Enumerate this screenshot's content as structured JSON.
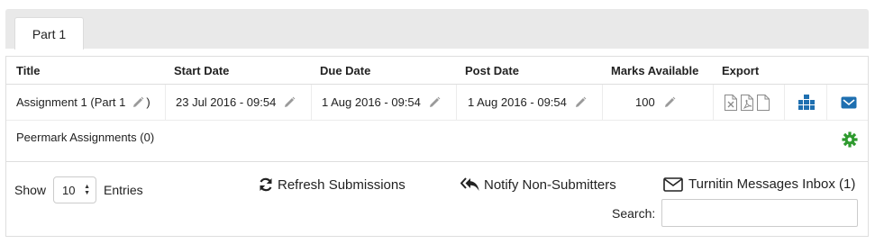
{
  "tabs": [
    {
      "label": "Part 1"
    }
  ],
  "table": {
    "headers": {
      "title": "Title",
      "start_date": "Start Date",
      "due_date": "Due Date",
      "post_date": "Post Date",
      "marks": "Marks Available",
      "export": "Export"
    },
    "row": {
      "title": "Assignment 1 (Part 1",
      "title_suffix": ")",
      "start_date": "23 Jul 2016 - 09:54",
      "due_date": "1 Aug 2016 - 09:54",
      "post_date": "1 Aug 2016 - 09:54",
      "marks": "100"
    }
  },
  "peermark": {
    "label": "Peermark Assignments (0)"
  },
  "controls": {
    "show_label": "Show",
    "entries_value": "10",
    "entries_label": "Entries",
    "refresh_label": "Refresh Submissions",
    "notify_label": "Notify Non-Submitters",
    "messages_label": "Turnitin Messages Inbox (1)",
    "search_label": "Search:",
    "search_value": ""
  },
  "icons": {
    "edit": "pencil-icon",
    "export_xls": "xls-file-icon",
    "export_pdf": "pdf-file-icon",
    "export_doc": "document-icon",
    "grademark": "grademark-icon",
    "messages": "envelope-icon",
    "peermark_settings": "gear-icon",
    "refresh": "refresh-icon",
    "notify": "reply-all-icon"
  },
  "colors": {
    "accent_blue": "#1e6fb0",
    "gear_green": "#2e9a2e",
    "icon_grey": "#999999"
  }
}
